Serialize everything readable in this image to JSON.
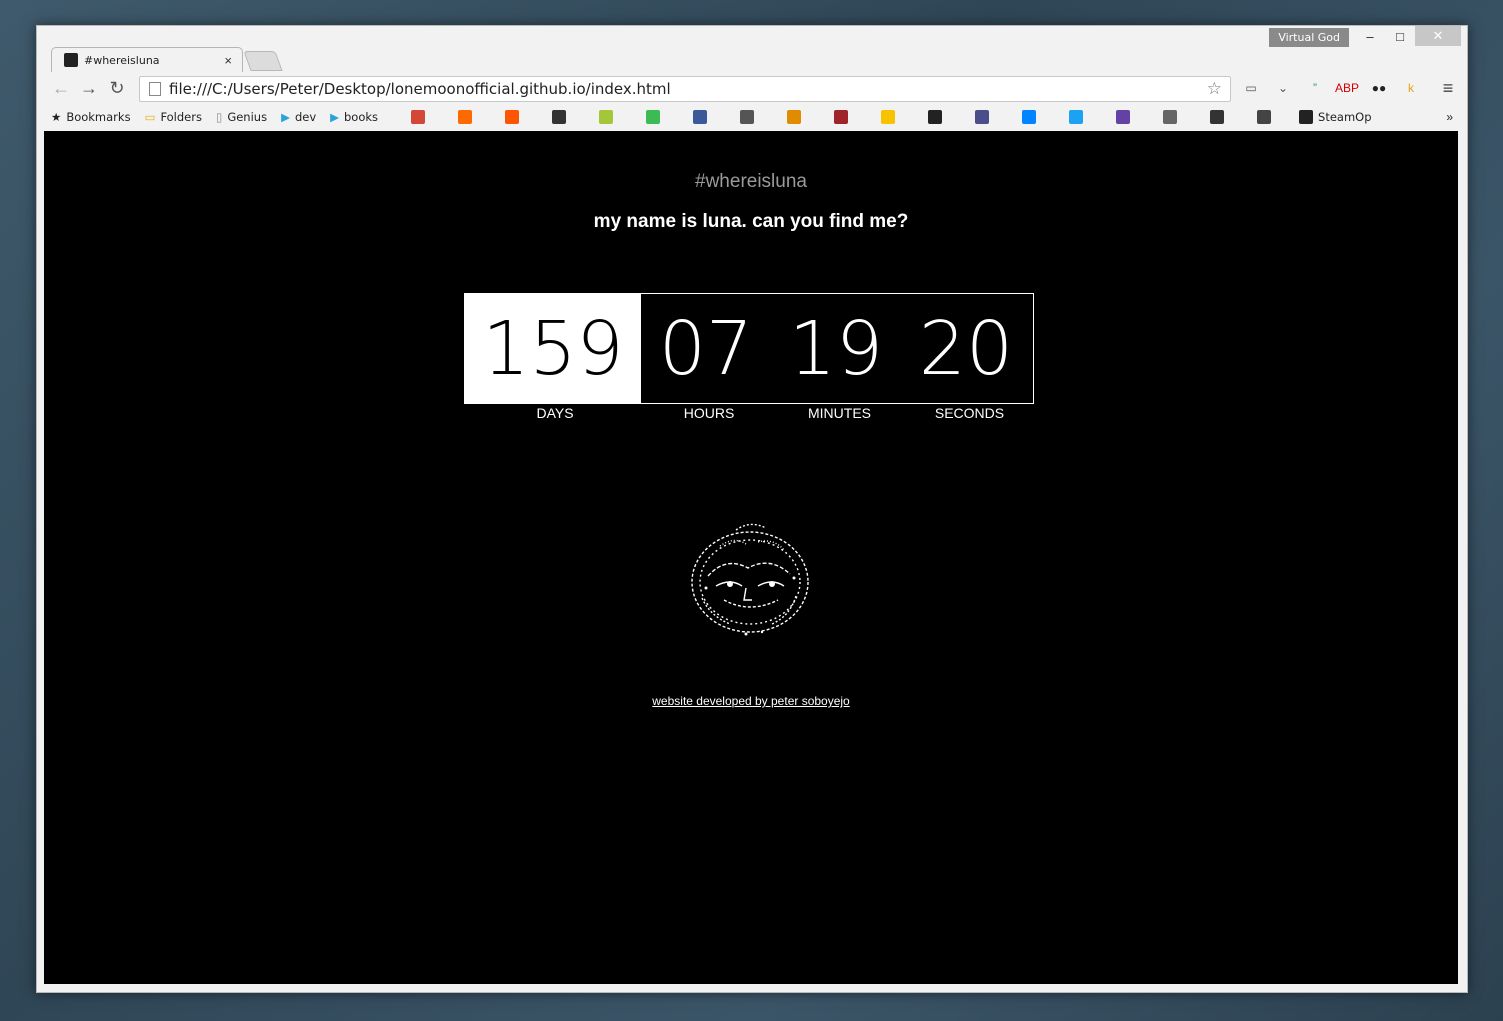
{
  "window": {
    "profile_label": "Virtual God",
    "minimize": "–",
    "maximize": "□",
    "close": "✕"
  },
  "tab": {
    "title": "#whereisluna",
    "close": "×"
  },
  "toolbar": {
    "back": "←",
    "forward": "→",
    "reload": "↻",
    "url": "file:///C:/Users/Peter/Desktop/lonemoonofficial.github.io/index.html",
    "star": "☆",
    "menu": "≡",
    "extensions": [
      {
        "name": "cast-icon",
        "glyph": "▭",
        "color": "#555555"
      },
      {
        "name": "pocket-icon",
        "glyph": "⌄",
        "color": "#555555"
      },
      {
        "name": "hangouts-icon",
        "glyph": "”",
        "color": "#1fa463"
      },
      {
        "name": "adblock-icon",
        "glyph": "ABP",
        "color": "#d40000"
      },
      {
        "name": "incognito-icon",
        "glyph": "●●",
        "color": "#222222"
      },
      {
        "name": "k-icon",
        "glyph": "k",
        "color": "#e8a317"
      }
    ]
  },
  "bookmarks": {
    "items": [
      {
        "label": "Bookmarks",
        "icon": "★"
      },
      {
        "label": "Folders",
        "icon": "📁"
      },
      {
        "label": "Genius",
        "icon": "🗋"
      },
      {
        "label": "dev",
        "icon": "▶"
      },
      {
        "label": "books",
        "icon": "▶"
      }
    ],
    "icons": [
      {
        "name": "gmail-icon",
        "color": "#d44638"
      },
      {
        "name": "headphones-icon",
        "color": "#ff6a00"
      },
      {
        "name": "soundcloud-icon",
        "color": "#ff5500"
      },
      {
        "name": "play-icon",
        "color": "#333333"
      },
      {
        "name": "android-icon",
        "color": "#a4c639"
      },
      {
        "name": "network-icon",
        "color": "#3cba54"
      },
      {
        "name": "facebook-icon",
        "color": "#3b5998"
      },
      {
        "name": "reddit-icon",
        "color": "#555555"
      },
      {
        "name": "shield-crest-icon",
        "color": "#e08b00"
      },
      {
        "name": "bars-icon",
        "color": "#a0232a"
      },
      {
        "name": "keep-icon",
        "color": "#f7c300"
      },
      {
        "name": "github-icon",
        "color": "#222222"
      },
      {
        "name": "h-icon",
        "color": "#4a4f8c"
      },
      {
        "name": "messenger-icon",
        "color": "#0084ff"
      },
      {
        "name": "twitter-icon",
        "color": "#1da1f2"
      },
      {
        "name": "twitch-icon",
        "color": "#6441a5"
      },
      {
        "name": "sword-icon",
        "color": "#666666"
      },
      {
        "name": "badge-icon",
        "color": "#333333"
      },
      {
        "name": "s-icon",
        "color": "#444444"
      }
    ],
    "steam_label": "SteamOp",
    "overflow": "»"
  },
  "page": {
    "hashtag": "#whereisluna",
    "subtitle": "my name is luna. can you find me?",
    "countdown": {
      "days": "159",
      "hours": "07",
      "minutes": "19",
      "seconds": "20",
      "days_label": "DAYS",
      "hours_label": "HOURS",
      "minutes_label": "MINUTES",
      "seconds_label": "SECONDS"
    },
    "credit": "website developed by peter soboyejo"
  }
}
